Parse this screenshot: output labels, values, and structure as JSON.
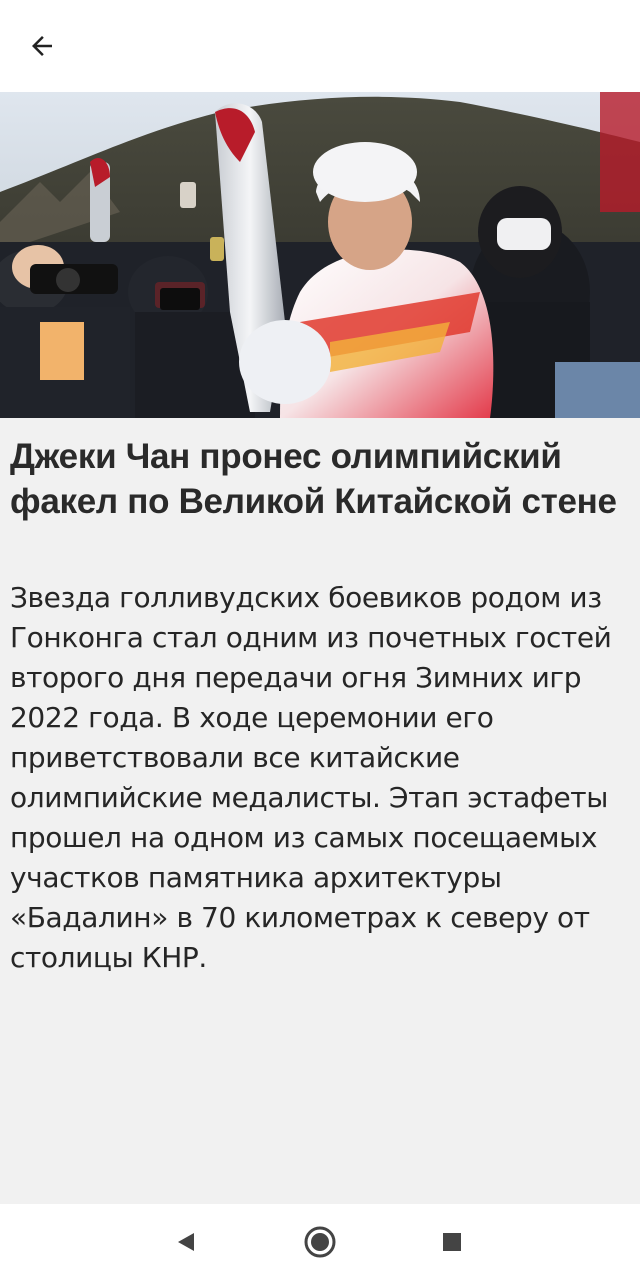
{
  "app_bar": {
    "back_icon": "arrow-left-icon"
  },
  "article": {
    "image_description_icon": "photo",
    "title": "Джеки Чан пронес олимпийский факел по Великой Китайской стене",
    "body": "Звезда голливудских боевиков родом из Гонконга стал одним из почетных гостей второго дня передачи огня Зимних игр 2022 года. В ходе церемонии его приветствовали все китайские олимпийские медалисты. Этап эстафеты прошел на одном из самых посещаемых участков памятника архитектуры «Бадалин» в 70 километрах к северу от столицы КНР."
  },
  "system_nav": {
    "back_icon": "triangle-back-icon",
    "home_icon": "circle-home-icon",
    "recent_icon": "square-recent-icon"
  },
  "colors": {
    "background": "#f1f1f1",
    "bar": "#ffffff",
    "text": "#262626",
    "nav_icons": "#444444"
  }
}
